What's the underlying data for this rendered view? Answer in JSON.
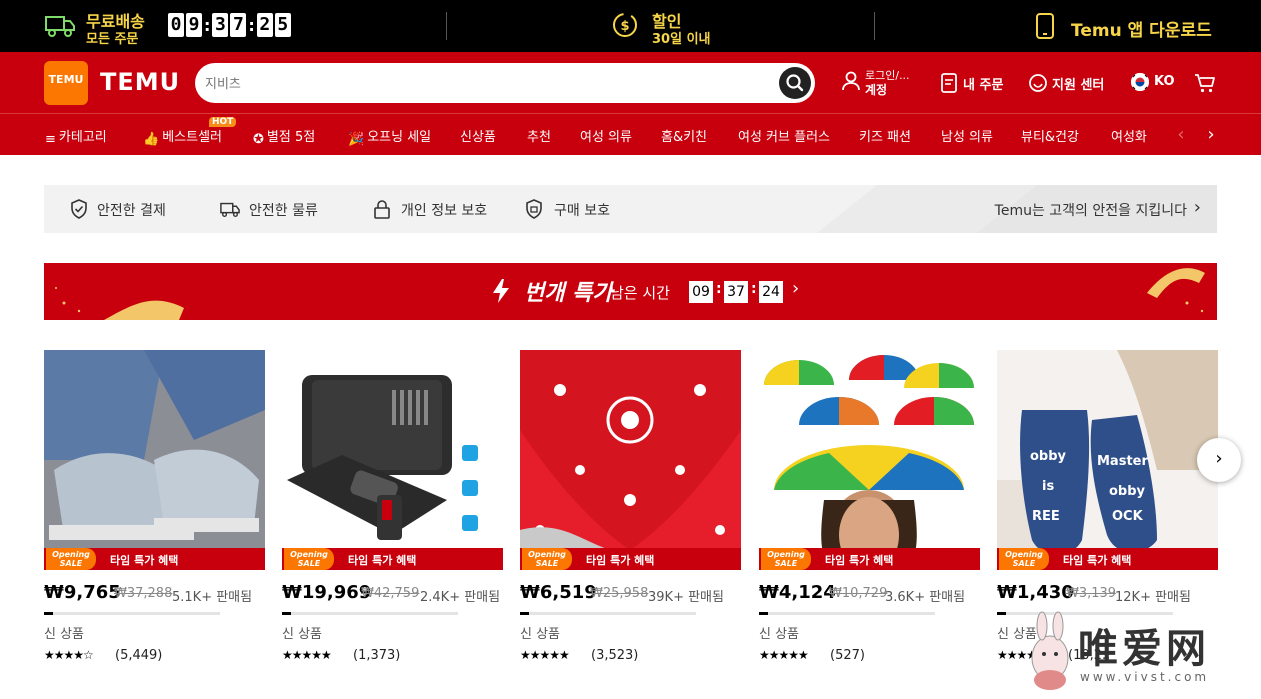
{
  "topbar": {
    "free_shipping": "무료배송",
    "all_orders": "모든 주문",
    "timer_digits": [
      "0",
      "9",
      "3",
      "7",
      "2",
      "5"
    ],
    "discount": "할인",
    "within_30": "30일 이내",
    "app_download": "Temu 앱 다운로드"
  },
  "header": {
    "logo_box": "TEMU",
    "logo_text": "TEMU",
    "search_placeholder": "지비츠",
    "login_line1": "로그인/...",
    "login_line2": "계정",
    "my_orders": "내 주문",
    "support": "지원 센터",
    "lang": "KO"
  },
  "nav": {
    "items": [
      "카테고리",
      "베스트셀러",
      "별점 5점",
      "오프닝 세일",
      "신상품",
      "추천",
      "여성 의류",
      "홈&키친",
      "여성 커브 플러스",
      "키즈 패션",
      "남성 의류",
      "뷰티&건강",
      "여성화"
    ],
    "hot_badge": "HOT"
  },
  "safety": {
    "items": [
      "안전한 결제",
      "안전한 물류",
      "개인 정보 보호",
      "구매 보호"
    ],
    "right_text": "Temu는 고객의 안전을 지킵니다"
  },
  "flash": {
    "title": "번개 특가",
    "remaining": "남은 시간",
    "hh": "09",
    "mm": "37",
    "ss": "24"
  },
  "products": [
    {
      "price": "₩9,765",
      "old": "₩37,288",
      "sold": "5.1K+ 판매됨",
      "badge": "타임 특가 혜택",
      "new": "신 상품",
      "rating": "★★★★☆",
      "reviews": "(5,449)",
      "progress": 0.05
    },
    {
      "price": "₩19,969",
      "old": "₩42,759",
      "sold": "2.4K+ 판매됨",
      "badge": "타임 특가 혜택",
      "new": "신 상품",
      "rating": "★★★★★",
      "reviews": "(1,373)",
      "progress": 0.05
    },
    {
      "price": "₩6,519",
      "old": "₩25,958",
      "sold": "39K+ 판매됨",
      "badge": "타임 특가 혜택",
      "new": "신 상품",
      "rating": "★★★★★",
      "reviews": "(3,523)",
      "progress": 0.05
    },
    {
      "price": "₩4,124",
      "old": "₩10,729",
      "sold": "3.6K+ 판매됨",
      "badge": "타임 특가 혜택",
      "new": "신 상품",
      "rating": "★★★★★",
      "reviews": "(527)",
      "progress": 0.05
    },
    {
      "price": "₩1,430",
      "old": "₩3,139",
      "sold": "12K+ 판매됨",
      "badge": "타임 특가 혜택",
      "new": "신 상품",
      "rating": "★★★★★",
      "reviews": "(10,2..",
      "progress": 0.05
    }
  ],
  "opening_sale": "Opening SALE",
  "watermark": {
    "text": "唯爱网",
    "url": "www.vivst.com"
  },
  "colors": {
    "brand_red": "#c8000d",
    "brand_orange": "#fb7701",
    "promo_yellow": "#f7d54a"
  }
}
